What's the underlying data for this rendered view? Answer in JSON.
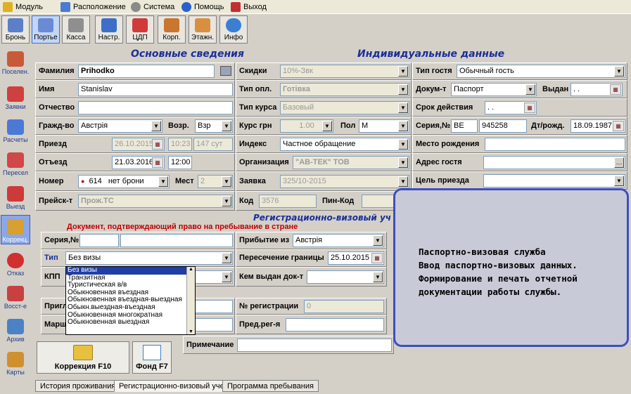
{
  "menu": [
    {
      "label": "Модуль",
      "icon": "module-icon",
      "color": "#e0b020"
    },
    {
      "label": "Расположение",
      "icon": "layout-icon",
      "color": "#4a7ad4"
    },
    {
      "label": "Система",
      "icon": "gear-icon",
      "color": "#8a8a8a"
    },
    {
      "label": "Помощь",
      "icon": "help-icon",
      "color": "#2a5fd0"
    },
    {
      "label": "Выход",
      "icon": "exit-icon",
      "color": "#c03030"
    }
  ],
  "toolbar": [
    {
      "label": "Бронь",
      "icon": "booking-icon",
      "color": "#5b7fc8"
    },
    {
      "label": "Портье",
      "icon": "porter-icon",
      "color": "#6a8ad6"
    },
    {
      "label": "Касса",
      "icon": "cash-register-icon",
      "color": "#8f8f8f"
    },
    {
      "label": "Настр.",
      "icon": "settings-icon",
      "color": "#3d6fc8"
    },
    {
      "label": "ЦДП",
      "icon": "cdp-icon",
      "color": "#d23a3a"
    },
    {
      "label": "Корп.",
      "icon": "corporate-icon",
      "color": "#c9762e"
    },
    {
      "label": "Этажн.",
      "icon": "floor-icon",
      "color": "#d89040"
    },
    {
      "label": "Инфо",
      "icon": "info-icon",
      "color": "#3a7fd4"
    }
  ],
  "sidebar": [
    {
      "label": "Поселен.",
      "icon": "checkin-icon",
      "color": "#c85a3a"
    },
    {
      "label": "Заявки",
      "icon": "requests-icon",
      "color": "#d04040"
    },
    {
      "label": "Расчеты",
      "icon": "calculations-icon",
      "color": "#4a7ad4"
    },
    {
      "label": "Пересел",
      "icon": "relocate-icon",
      "color": "#d04848"
    },
    {
      "label": "Выезд",
      "icon": "checkout-icon",
      "color": "#cc3a3a"
    },
    {
      "label": "Коррекц.",
      "icon": "correction-icon",
      "color": "#d8a030"
    },
    {
      "label": "Отказ",
      "icon": "refuse-icon",
      "color": "#d03030"
    },
    {
      "label": "Восст-е",
      "icon": "restore-icon",
      "color": "#c84040"
    },
    {
      "label": "Архив",
      "icon": "archive-icon",
      "color": "#4a82c8"
    },
    {
      "label": "Карты",
      "icon": "cards-icon",
      "color": "#d09030"
    }
  ],
  "headers": {
    "main": "Основные сведения",
    "individual": "Индивидуальные данные",
    "visa": "Регистрационно-визовый уч"
  },
  "main": {
    "surname": {
      "label": "Фамилия",
      "value": "Prihodko"
    },
    "name": {
      "label": "Имя",
      "value": "Stanislav"
    },
    "patronymic": {
      "label": "Отчество",
      "value": ""
    },
    "citizenship": {
      "label": "Гражд-во",
      "value": "Австрія"
    },
    "age": {
      "label": "Возр.",
      "value": "Взр"
    },
    "arrival": {
      "label": "Приезд",
      "date": "26.10.2015",
      "time": "10:23",
      "days": "147 сут"
    },
    "departure": {
      "label": "Отъезд",
      "date": "21.03.2016",
      "time": "12:00"
    },
    "room": {
      "label": "Номер",
      "number": "614",
      "status": "нет брони"
    },
    "places": {
      "label": "Мест",
      "value": "2"
    },
    "pricelist": {
      "label": "Прейск-т",
      "value": "Прож.ТС"
    }
  },
  "middle": {
    "discount": {
      "label": "Скидки",
      "value": "10%-Звк"
    },
    "payment": {
      "label": "Тип опл.",
      "value": "Готівка"
    },
    "rate_type": {
      "label": "Тип курса",
      "value": "Базовый"
    },
    "rate": {
      "label": "Курс грн",
      "value": "1.00"
    },
    "gender": {
      "label": "Пол",
      "value": "М"
    },
    "index": {
      "label": "Индекс",
      "value": "Частное обращение"
    },
    "organization": {
      "label": "Организация",
      "value": "\"АВ-ТЕК\" ТОВ"
    },
    "request": {
      "label": "Заявка",
      "value": "325/10-2015"
    },
    "code": {
      "label": "Код",
      "value": "3576"
    },
    "pin": {
      "label": "Пин-Код",
      "value": ""
    }
  },
  "individual": {
    "guest_type": {
      "label": "Тип гостя",
      "value": "Обычный гость"
    },
    "document": {
      "label": "Докум-т",
      "value": "Паспорт"
    },
    "issued": {
      "label": "Выдан",
      "value": ". ."
    },
    "validity": {
      "label": "Срок действия",
      "value": ". ."
    },
    "series": {
      "label": "Серия,№",
      "series": "BE",
      "number": "945258"
    },
    "birth": {
      "label": "Дт/рожд.",
      "value": "18.09.1987"
    },
    "birthplace": {
      "label": "Место рождения",
      "value": ""
    },
    "address": {
      "label": "Адрес гостя",
      "value": ""
    },
    "purpose": {
      "label": "Цель приезда",
      "value": ""
    }
  },
  "visa": {
    "doc_title": "Документ, подтверждающий право на пребывание в стране",
    "series": {
      "label": "Серия,№",
      "value": ""
    },
    "type": {
      "label": "Тип",
      "value": "Без визы"
    },
    "kpp": {
      "label": "КПП"
    },
    "invite": {
      "label": "Пригл"
    },
    "route": {
      "label": "Марш"
    },
    "arrival_from": {
      "label": "Прибытие из",
      "value": "Австрія"
    },
    "border": {
      "label": "Пересечение границы",
      "value": "25.10.2015"
    },
    "issued_by": {
      "label": "Кем выдан док-т",
      "value": ""
    },
    "reg_number": {
      "label": "№ регистрации",
      "value": "0"
    },
    "prev_reg": {
      "label": "Пред.рег-я",
      "value": ""
    },
    "note": {
      "label": "Примечание",
      "value": ""
    },
    "type_options": [
      "Без визы",
      "Транзитная",
      "Туристическая в/в",
      "Обыкновенная въездная",
      "Обыкновенная въездная-выездная",
      "Обыкн.выездная-въездная",
      "Обыкновенная многократная",
      "Обыкновенная выездная"
    ]
  },
  "buttons": {
    "correction": "Коррекция F10",
    "fund": "Фонд F7"
  },
  "tabs": [
    "История проживания",
    "Регистрационно-визовый учет",
    "Программа пребывания"
  ],
  "popup": {
    "lines": [
      "Паспортно-визовая служба",
      "Ввод паспортно-визовых данных.",
      "Формирование и печать отчетной",
      "документации работы службы."
    ],
    "border_color": "#3d4fc0"
  }
}
